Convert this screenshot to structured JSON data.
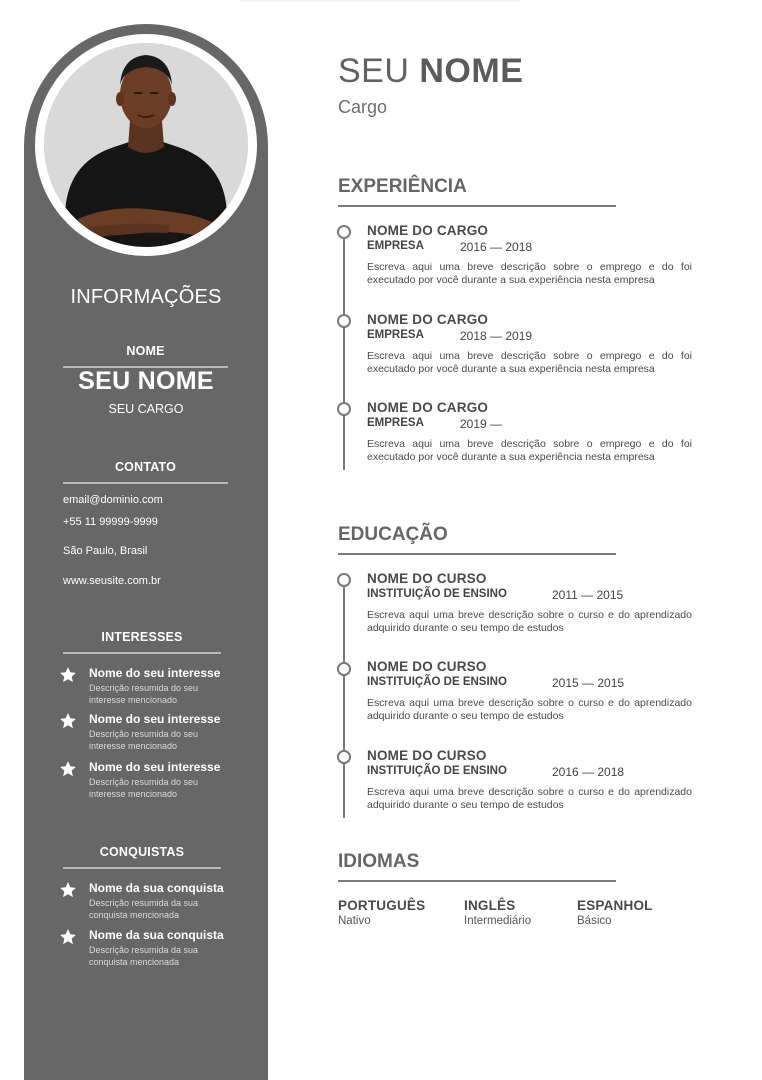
{
  "header": {
    "name_light": "SEU",
    "name_bold": "NOME",
    "role": "Cargo"
  },
  "sidebar": {
    "info_title": "INFORMAÇÕES",
    "name_section": {
      "label": "NOME",
      "name": "SEU NOME",
      "role": "SEU CARGO"
    },
    "contact": {
      "label": "CONTATO",
      "email": "email@dominio.com",
      "phone": "+55 11 99999-9999",
      "location": "São Paulo, Brasil",
      "website": "www.seusite.com.br"
    },
    "interests": {
      "label": "INTERESSES",
      "items": [
        {
          "title": "Nome do seu interesse",
          "desc": "Descrição resumida do seu interesse mencionado"
        },
        {
          "title": "Nome do seu interesse",
          "desc": "Descrição resumida do seu interesse mencionado"
        },
        {
          "title": "Nome do seu interesse",
          "desc": "Descrição resumida do seu interesse mencionado"
        }
      ]
    },
    "achievements": {
      "label": "CONQUISTAS",
      "items": [
        {
          "title": "Nome da sua conquista",
          "desc": "Descrição resumida da sua conquista mencionada"
        },
        {
          "title": "Nome da sua conquista",
          "desc": "Descrição resumida da sua conquista mencionada"
        }
      ]
    }
  },
  "experience": {
    "heading": "EXPERIÊNCIA",
    "items": [
      {
        "title": "NOME DO CARGO",
        "org": "EMPRESA",
        "period": "2016 — 2018",
        "desc": "Escreva aqui uma breve descrição sobre o emprego e do foi executado por você durante a sua experiência nesta empresa"
      },
      {
        "title": "NOME DO CARGO",
        "org": "EMPRESA",
        "period": "2018 — 2019",
        "desc": "Escreva aqui uma breve descrição sobre o emprego e do foi executado por você durante a sua experiência nesta empresa"
      },
      {
        "title": "NOME DO CARGO",
        "org": "EMPRESA",
        "period": "2019 —",
        "desc": "Escreva aqui uma breve descrição sobre o emprego e do foi executado por você durante a sua experiência nesta empresa"
      }
    ]
  },
  "education": {
    "heading": "EDUCAÇÃO",
    "items": [
      {
        "title": "NOME DO CURSO",
        "org": "INSTITUIÇÃO DE ENSINO",
        "period": "2011 — 2015",
        "desc": "Escreva aqui uma breve descrição sobre o curso e do aprendizado adquirido durante o seu tempo de estudos"
      },
      {
        "title": "NOME DO CURSO",
        "org": "INSTITUIÇÃO DE ENSINO",
        "period": "2015 — 2015",
        "desc": "Escreva aqui uma breve descrição sobre o curso e do aprendizado adquirido durante o seu tempo de estudos"
      },
      {
        "title": "NOME DO CURSO",
        "org": "INSTITUIÇÃO DE ENSINO",
        "period": "2016 — 2018",
        "desc": "Escreva aqui uma breve descrição sobre o curso e do aprendizado adquirido durante o seu tempo de estudos"
      }
    ]
  },
  "languages": {
    "heading": "IDIOMAS",
    "items": [
      {
        "name": "PORTUGUÊS",
        "level": "Nativo"
      },
      {
        "name": "INGLÊS",
        "level": "Intermediário"
      },
      {
        "name": "ESPANHOL",
        "level": "Básico"
      }
    ]
  },
  "icons": {
    "bullet": "star-icon",
    "photo": "profile-photo"
  },
  "colors": {
    "sidebar": "#676767",
    "accent": "#7a7a7a",
    "text": "#3a3a3a"
  }
}
